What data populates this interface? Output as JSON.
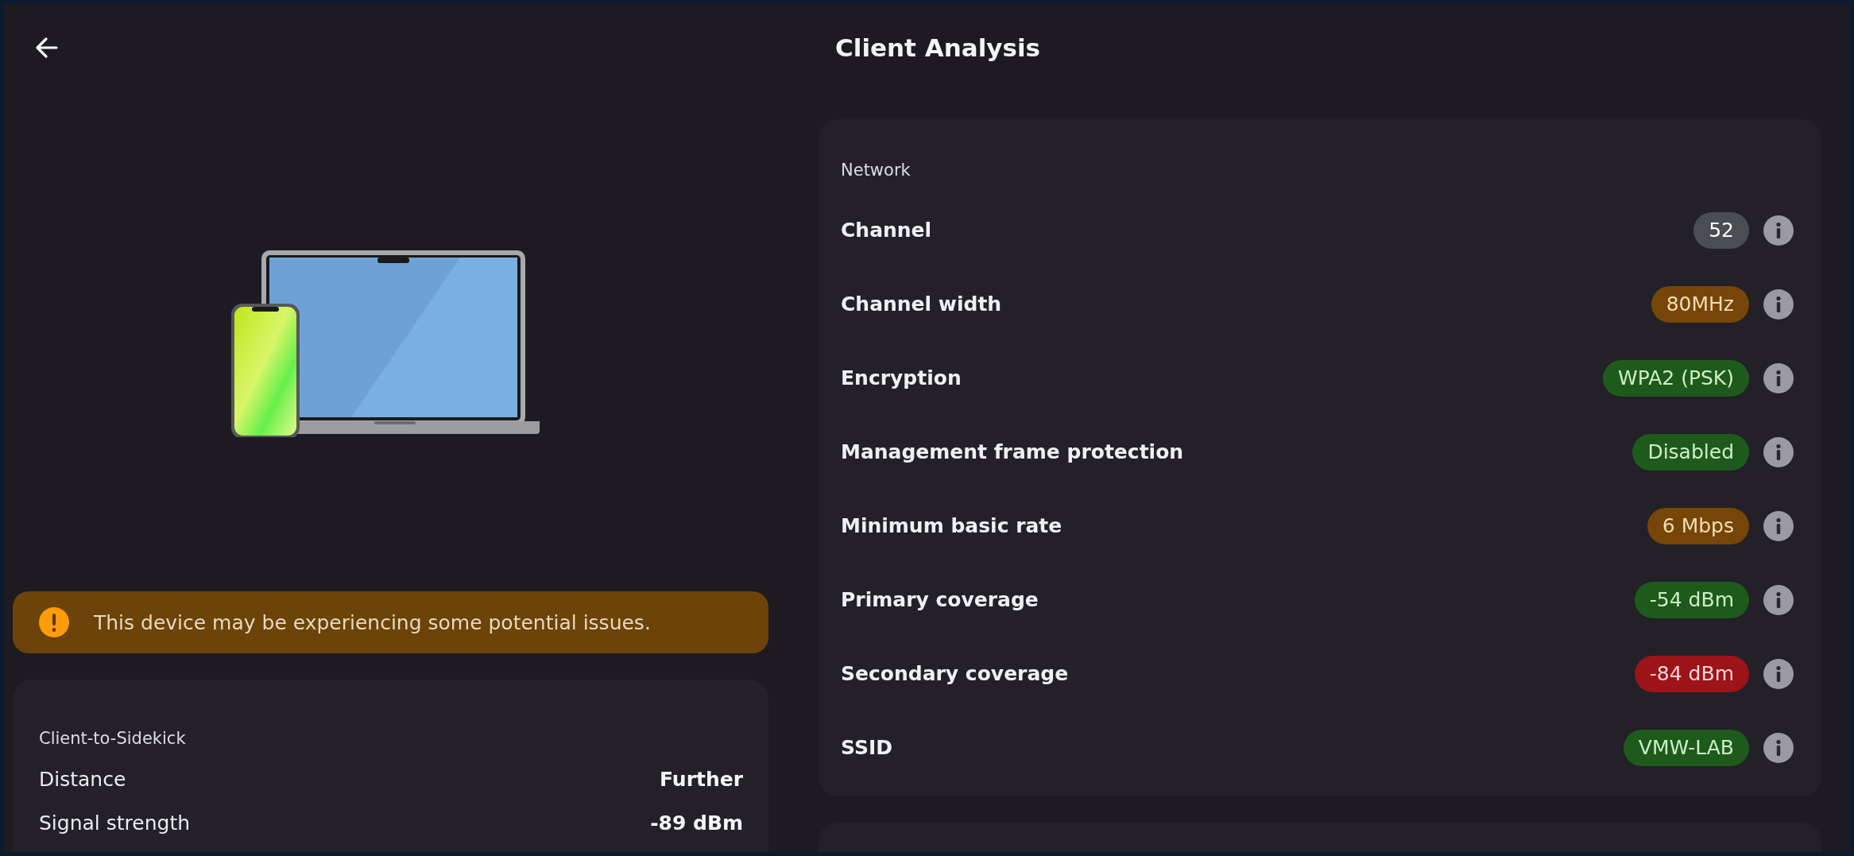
{
  "header": {
    "title": "Client Analysis"
  },
  "warning": {
    "text": "This device may be experiencing some potential issues."
  },
  "client_to_sidekick": {
    "heading": "Client-to-Sidekick",
    "rows": [
      {
        "label": "Distance",
        "value": "Further"
      },
      {
        "label": "Signal strength",
        "value": "-89 dBm"
      }
    ]
  },
  "network": {
    "heading": "Network",
    "rows": [
      {
        "label": "Channel",
        "value": "52",
        "color": "#4a4d52"
      },
      {
        "label": "Channel width",
        "value": "80MHz",
        "color": "#764608"
      },
      {
        "label": "Encryption",
        "value": "WPA2 (PSK)",
        "color": "#1e5a1c"
      },
      {
        "label": "Management frame protection",
        "value": "Disabled",
        "color": "#1e5a1c"
      },
      {
        "label": "Minimum basic rate",
        "value": "6 Mbps",
        "color": "#764608"
      },
      {
        "label": "Primary coverage",
        "value": "-54 dBm",
        "color": "#1e5a1c"
      },
      {
        "label": "Secondary coverage",
        "value": "-84 dBm",
        "color": "#9c1318"
      },
      {
        "label": "SSID",
        "value": "VMW-LAB",
        "color": "#1e5a1c"
      }
    ]
  }
}
